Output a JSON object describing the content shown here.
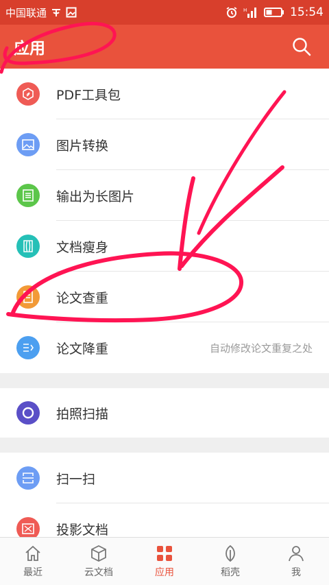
{
  "status_bar": {
    "carrier": "中国联通",
    "time": "15:54",
    "icons": [
      "wechat-icon",
      "image-icon",
      "alarm-icon",
      "signal-icon",
      "battery-icon"
    ]
  },
  "header": {
    "title": "应用",
    "search_icon": "search-icon"
  },
  "section1": {
    "items": [
      {
        "label": "PDF工具包",
        "icon": "pdf-icon",
        "color": "#ef5b55"
      },
      {
        "label": "图片转换",
        "icon": "image-convert-icon",
        "color": "#6d9df4"
      },
      {
        "label": "输出为长图片",
        "icon": "long-image-icon",
        "color": "#5cc64a"
      },
      {
        "label": "文档瘦身",
        "icon": "slim-doc-icon",
        "color": "#25c0b7"
      },
      {
        "label": "论文查重",
        "icon": "paper-check-icon",
        "color": "#f29a37"
      },
      {
        "label": "论文降重",
        "icon": "paper-reduce-icon",
        "color": "#4c9ff0",
        "hint": "自动修改论文重复之处"
      }
    ]
  },
  "section2": {
    "items": [
      {
        "label": "拍照扫描",
        "icon": "scan-camera-icon",
        "color": "#5a4fc7"
      }
    ]
  },
  "section3": {
    "items": [
      {
        "label": "扫一扫",
        "icon": "qr-scan-icon",
        "color": "#6d9df4"
      },
      {
        "label": "投影文档",
        "icon": "projection-icon",
        "color": "#ef5b55"
      }
    ]
  },
  "bottom_nav": {
    "tabs": [
      {
        "label": "最近",
        "icon": "home-icon"
      },
      {
        "label": "云文档",
        "icon": "cube-icon"
      },
      {
        "label": "应用",
        "icon": "apps-grid-icon",
        "active": true
      },
      {
        "label": "稻壳",
        "icon": "leaf-icon"
      },
      {
        "label": "我",
        "icon": "person-icon"
      }
    ]
  },
  "colors": {
    "status_bar": "#d83f2c",
    "header": "#e9523c",
    "annotation": "#ff1453",
    "active_tab": "#e9523c"
  }
}
